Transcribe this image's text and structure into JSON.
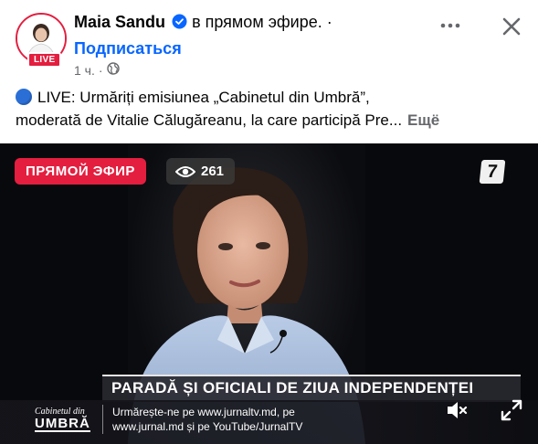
{
  "header": {
    "name": "Maia Sandu",
    "status": "в прямом эфире.",
    "separator": "·",
    "subscribe": "Подписаться",
    "time": "1 ч.",
    "dot": "·",
    "live_badge": "LIVE",
    "more_icon": "more-horizontal-icon",
    "close_icon": "close-icon",
    "privacy_icon": "globe-icon"
  },
  "post": {
    "line1": "LIVE: Urmăriți emisiunea „Cabinetul din Umbră”,",
    "line2": "moderată de Vitalie Călugăreanu, la care participă Pre...",
    "see_more": "Ещё"
  },
  "video": {
    "live_tag": "ПРЯМОЙ ЭФИР",
    "viewers": "261",
    "channel_logo": "7",
    "headline": "PARADĂ ȘI OFICIALI DE ZIUA INDEPENDENȚEI",
    "show_name_top": "Cabinetul din",
    "show_name_bottom": "UMBRĂ",
    "ticker_line1": "Urmărește-ne pe www.jurnaltv.md, pe",
    "ticker_line2": "www.jurnal.md și pe YouTube/JurnalTV"
  },
  "colors": {
    "live_red": "#e41e3f",
    "link_blue": "#0866ff",
    "secondary_text": "#65676b"
  }
}
